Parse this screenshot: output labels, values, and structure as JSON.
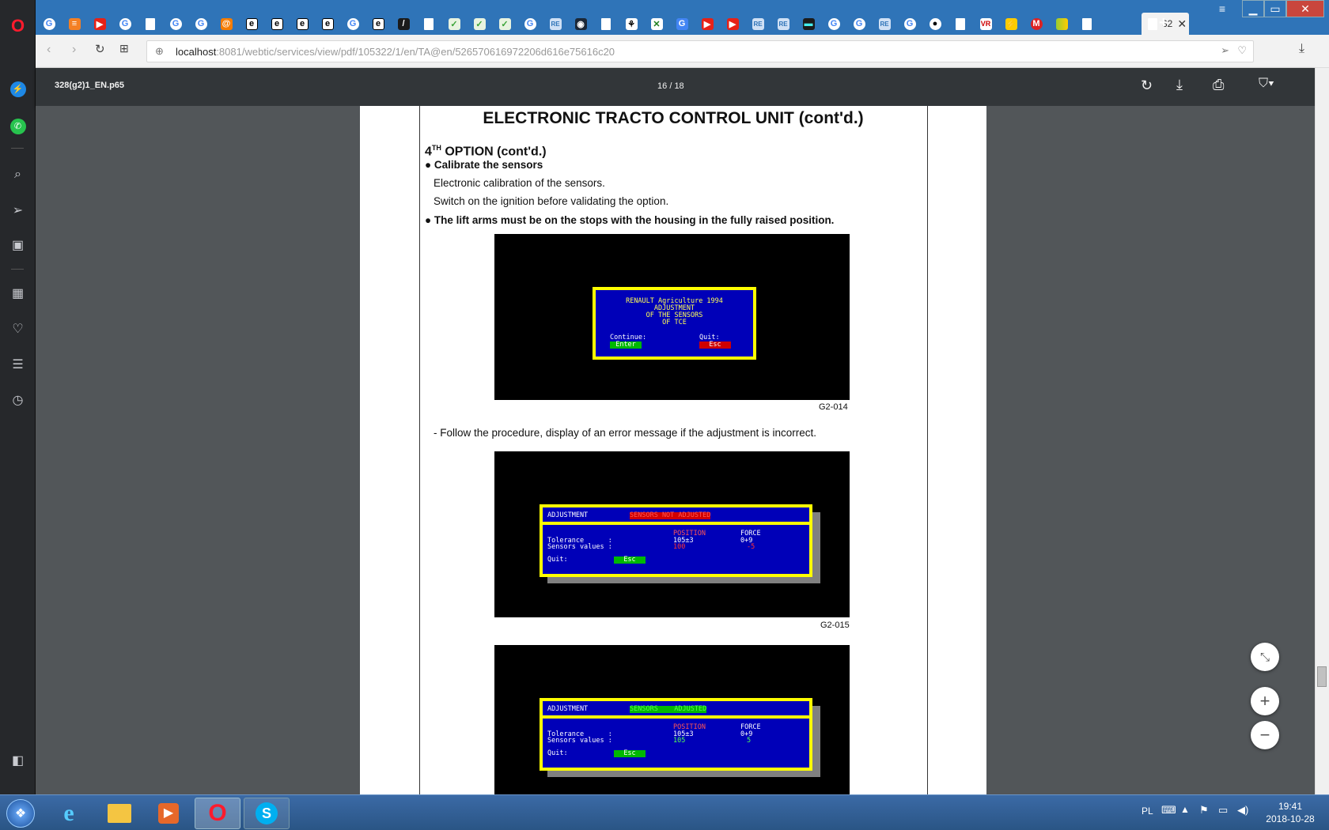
{
  "window": {
    "tab_title": "32",
    "url_host": "localhost",
    "url_rest": ":8081/webtic/services/view/pdf/105322/1/en/TA@en/526570616972206d616e75616c20"
  },
  "pdf_toolbar": {
    "filename": "328(g2)1_EN.p65",
    "page_current": "16",
    "page_sep": "/",
    "page_total": "18"
  },
  "document": {
    "title": "ELECTRONIC TRACTO CONTROL UNIT (cont'd.)",
    "section_prefix": "4",
    "section_sup": "TH",
    "section_rest": " OPTION (cont'd.)",
    "bullet1": "Calibrate the sensors",
    "line1": "Electronic calibration of the sensors.",
    "line2": "Switch on the ignition before validating the option.",
    "bullet2": "The lift arms must be on the stops with the housing in the fully raised position.",
    "caption1": "G2-014",
    "step": "-  Follow the procedure, display of an error message if the adjustment is incorrect.",
    "caption2": "G2-015"
  },
  "screen1": {
    "line1": "RENAULT Agriculture 1994",
    "line2": "ADJUSTMENT",
    "line3": "OF THE SENSORS",
    "line4": "OF TCE",
    "continue_label": "Continue:",
    "quit_label": "Quit:",
    "enter_btn": "Enter",
    "esc_btn": "Esc"
  },
  "screen2": {
    "header": "ADJUSTMENT",
    "status": "SENSORS NOT ADJUSTED",
    "col_position": "POSITION",
    "col_force": "FORCE",
    "tolerance_label": "Tolerance      :",
    "tolerance_pos": "105±3",
    "tolerance_force": "0+9",
    "values_label": "Sensors values :",
    "values_pos": "100",
    "values_force": "-5",
    "quit_label": "Quit:",
    "esc_btn": "Esc"
  },
  "screen3": {
    "header": "ADJUSTMENT",
    "status": "SENSORS    ADJUSTED",
    "col_position": "POSITION",
    "col_force": "FORCE",
    "tolerance_label": "Tolerance      :",
    "tolerance_pos": "105±3",
    "tolerance_force": "0+9",
    "values_label": "Sensors values :",
    "values_pos": "105",
    "values_force": "5",
    "quit_label": "Quit:",
    "esc_btn": "Esc"
  },
  "taskbar": {
    "language": "PL",
    "time": "19:41",
    "date": "2018-10-28"
  },
  "colors": {
    "tabbar": "#2f74b8",
    "pdf_toolbar": "#323639",
    "viewer_bg": "#525659",
    "dos_blue": "#0000b8",
    "dos_yellow": "#ffff00"
  }
}
